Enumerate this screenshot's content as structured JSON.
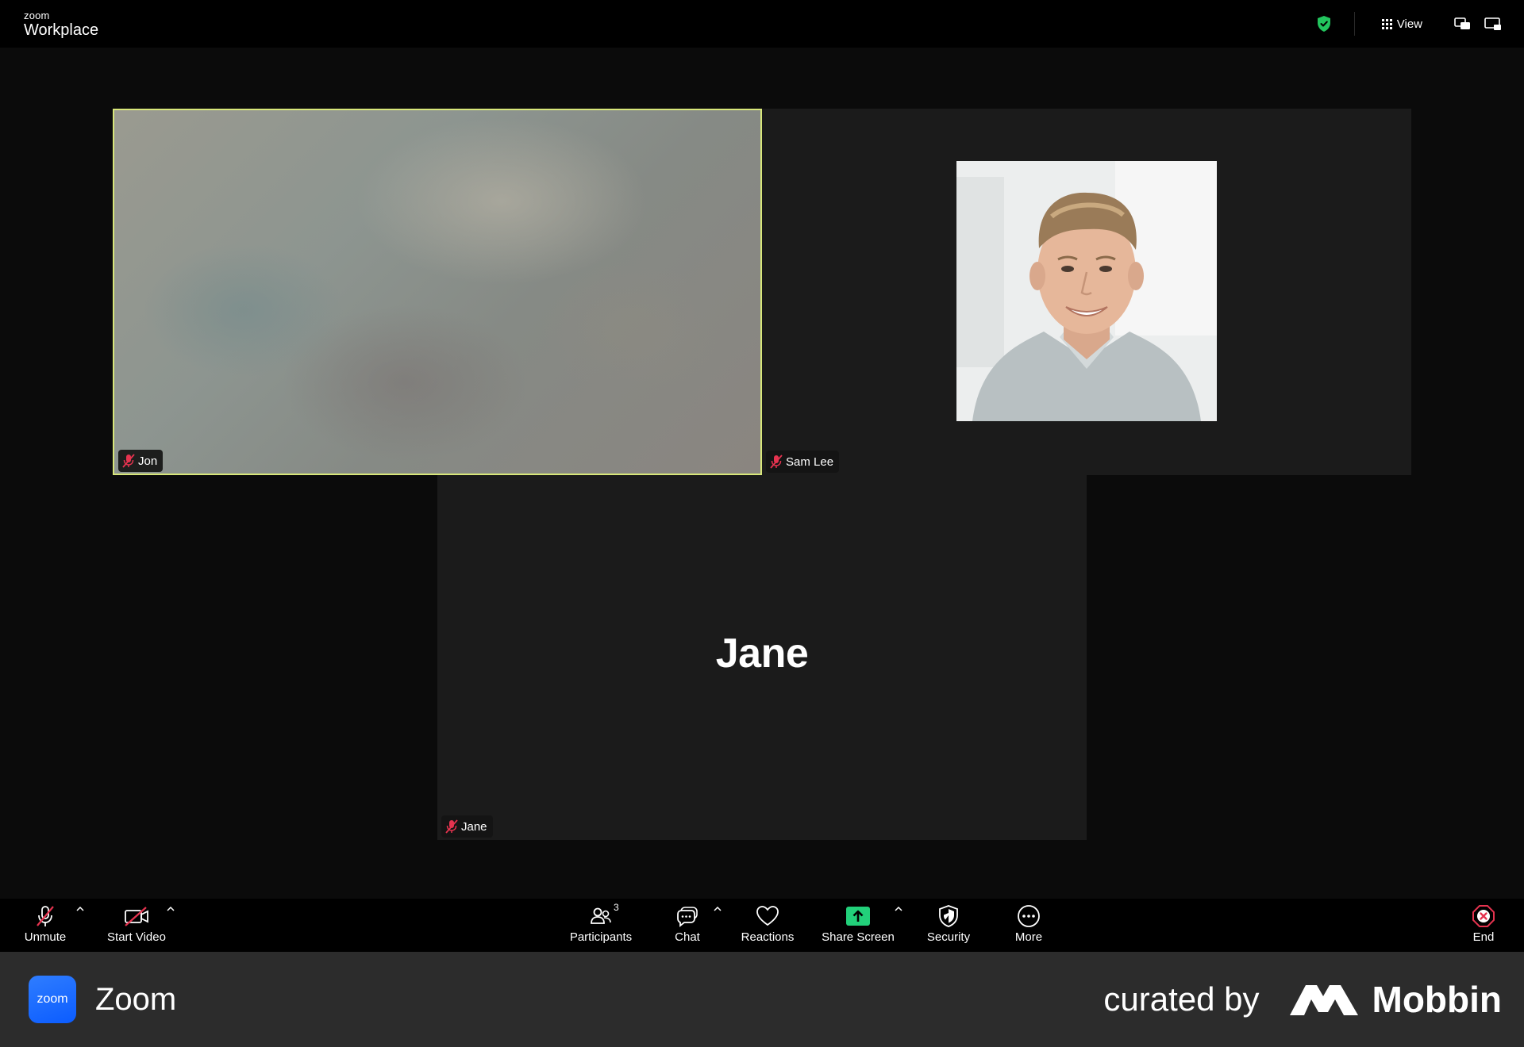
{
  "window": {
    "brand_small": "zoom",
    "brand_big": "Workplace",
    "view_label": "View"
  },
  "participants": {
    "jon": {
      "name": "Jon"
    },
    "sam": {
      "name": "Sam Lee"
    },
    "jane": {
      "name": "Jane",
      "display_name": "Jane"
    }
  },
  "toolbar": {
    "unmute": "Unmute",
    "start_video": "Start Video",
    "participants": "Participants",
    "participants_count": "3",
    "chat": "Chat",
    "reactions": "Reactions",
    "share_screen": "Share Screen",
    "security": "Security",
    "more": "More",
    "end": "End"
  },
  "footer": {
    "logo_text": "zoom",
    "app_name": "Zoom",
    "curated_by": "curated by",
    "curator": "Mobbin"
  },
  "colors": {
    "active_speaker_border": "#d8e77a",
    "share_green": "#22d07a",
    "end_red": "#e5334f",
    "zoom_blue": "#0b5cff",
    "mute_red": "#e5334f"
  }
}
